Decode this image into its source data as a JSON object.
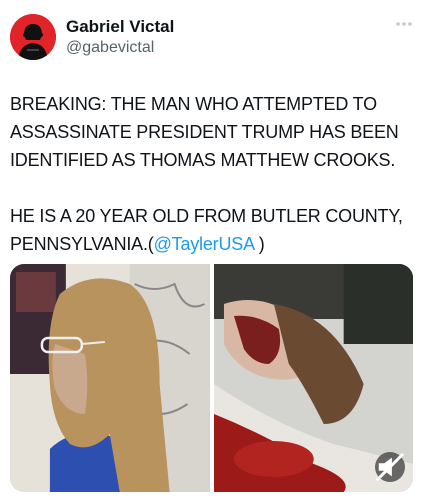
{
  "post": {
    "author": {
      "display_name": "Gabriel Victal",
      "handle": "@gabevictal",
      "avatar_icon": "avatar-icon"
    },
    "more_icon": "more-horizontal-icon",
    "paragraph1": "BREAKING: THE MAN WHO ATTEMPTED TO ASSASSINATE PRESIDENT TRUMP HAS BEEN IDENTIFIED AS THOMAS MATTHEW CROOKS.",
    "paragraph2_prefix": "HE IS A 20 YEAR OLD FROM BUTLER COUNTY, PENNSYLVANIA.(",
    "paragraph2_mention": "@TaylerUSA",
    "paragraph2_suffix": " )",
    "mute_icon": "volume-muted-icon",
    "colors": {
      "link": "#1d9bf0",
      "text": "#0f1419",
      "secondary": "#536471",
      "avatar_bg": "#e0242a"
    }
  }
}
